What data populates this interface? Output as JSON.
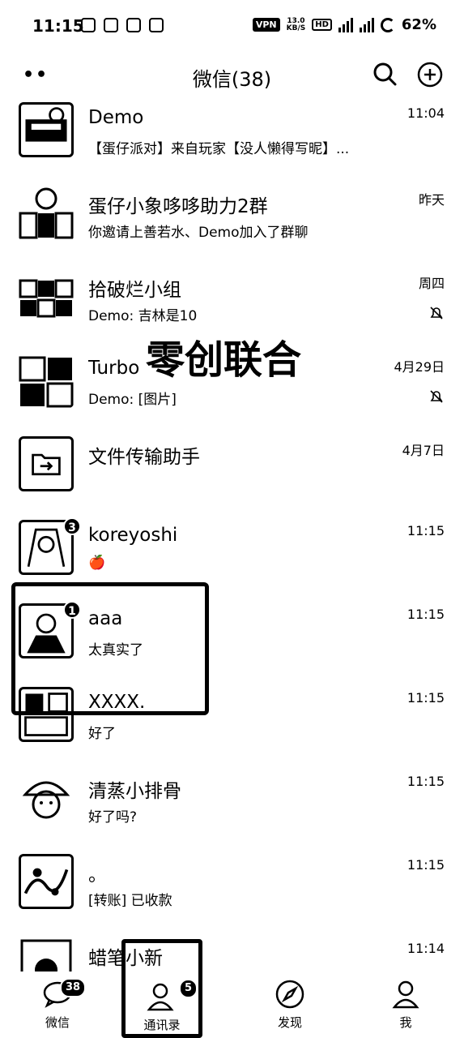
{
  "status_bar": {
    "time": "11:15",
    "vpn": "VPN",
    "speed_top": "13.0",
    "speed_bottom": "KB/S",
    "hd": "HD",
    "battery": "62%"
  },
  "header": {
    "title": "微信(38)"
  },
  "watermark": "零创联合",
  "chats": [
    {
      "name": "Demo",
      "preview": "【蛋仔派对】来自玩家【没人懒得写昵】...",
      "time": "11:04",
      "muted": false,
      "badge": ""
    },
    {
      "name": "蛋仔小象哆哆助力2群",
      "preview": "你邀请上善若水、Demo加入了群聊",
      "time": "昨天",
      "muted": false,
      "badge": ""
    },
    {
      "name": "拾破烂小组",
      "preview": "Demo: 吉林是10",
      "time": "周四",
      "muted": true,
      "badge": ""
    },
    {
      "name": "Turbo",
      "preview": "Demo: [图片]",
      "time": "4月29日",
      "muted": true,
      "badge": ""
    },
    {
      "name": "文件传输助手",
      "preview": "",
      "time": "4月7日",
      "muted": false,
      "badge": ""
    },
    {
      "name": "koreyoshi",
      "preview": "🍎",
      "time": "11:15",
      "muted": false,
      "badge": "3"
    },
    {
      "name": "aaa",
      "preview": "太真实了",
      "time": "11:15",
      "muted": false,
      "badge": "1"
    },
    {
      "name": "XXXX.",
      "preview": "好了",
      "time": "11:15",
      "muted": false,
      "badge": ""
    },
    {
      "name": "清蒸小排骨",
      "preview": "好了吗?",
      "time": "11:15",
      "muted": false,
      "badge": ""
    },
    {
      "name": "。",
      "preview": "[转账] 已收款",
      "time": "11:15",
      "muted": false,
      "badge": ""
    },
    {
      "name": "蜡笔小新",
      "preview": "",
      "time": "11:14",
      "muted": false,
      "badge": ""
    }
  ],
  "tabs": [
    {
      "label": "微信",
      "icon": "chat-bubble-icon",
      "badge": "38"
    },
    {
      "label": "通讯录",
      "icon": "contacts-icon",
      "badge": "5"
    },
    {
      "label": "发现",
      "icon": "compass-icon",
      "badge": ""
    },
    {
      "label": "我",
      "icon": "person-icon",
      "badge": ""
    }
  ]
}
